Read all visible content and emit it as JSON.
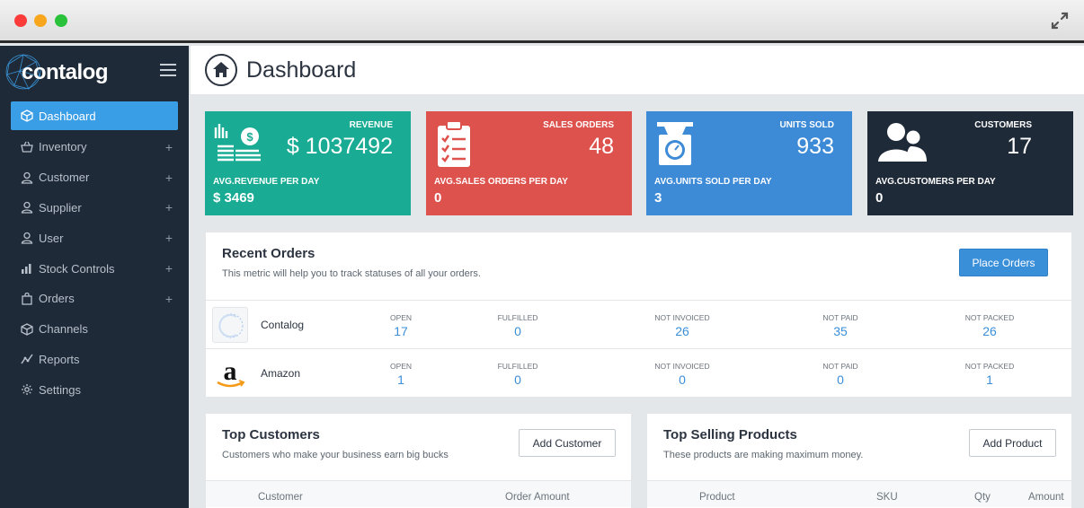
{
  "sidebar": {
    "logo": "contalog",
    "items": [
      {
        "label": "Dashboard",
        "icon": "cube-icon",
        "active": true,
        "expandable": false
      },
      {
        "label": "Inventory",
        "icon": "basket-icon",
        "active": false,
        "expandable": true
      },
      {
        "label": "Customer",
        "icon": "user-icon",
        "active": false,
        "expandable": true
      },
      {
        "label": "Supplier",
        "icon": "user-icon",
        "active": false,
        "expandable": true
      },
      {
        "label": "User",
        "icon": "user-icon",
        "active": false,
        "expandable": true
      },
      {
        "label": "Stock Controls",
        "icon": "bar-chart-icon",
        "active": false,
        "expandable": true
      },
      {
        "label": "Orders",
        "icon": "bag-icon",
        "active": false,
        "expandable": true
      },
      {
        "label": "Channels",
        "icon": "cube-icon",
        "active": false,
        "expandable": false
      },
      {
        "label": "Reports",
        "icon": "line-chart-icon",
        "active": false,
        "expandable": false
      },
      {
        "label": "Settings",
        "icon": "gear-icon",
        "active": false,
        "expandable": false
      }
    ],
    "plus": "+"
  },
  "header": {
    "title": "Dashboard"
  },
  "cards": [
    {
      "label": "REVENUE",
      "value": "$ 1037492",
      "sub_label": "AVG.REVENUE PER DAY",
      "sub_value": "$ 3469",
      "color": "#1aab94",
      "icon": "money-stack-icon"
    },
    {
      "label": "SALES ORDERS",
      "value": "48",
      "sub_label": "AVG.SALES ORDERS PER DAY",
      "sub_value": "0",
      "color": "#dd524d",
      "icon": "clipboard-icon"
    },
    {
      "label": "UNITS SOLD",
      "value": "933",
      "sub_label": "AVG.UNITS SOLD PER DAY",
      "sub_value": "3",
      "color": "#3d8ad6",
      "icon": "scale-icon"
    },
    {
      "label": "CUSTOMERS",
      "value": "17",
      "sub_label": "AVG.CUSTOMERS PER DAY",
      "sub_value": "0",
      "color": "#1f2a38",
      "icon": "users-icon"
    }
  ],
  "recent_orders": {
    "title": "Recent Orders",
    "subtitle": "This metric will help you to track statuses of all your orders.",
    "button": "Place Orders",
    "columns": [
      "OPEN",
      "FULFILLED",
      "NOT INVOICED",
      "NOT PAID",
      "NOT PACKED"
    ],
    "rows": [
      {
        "channel": "Contalog",
        "values": [
          "17",
          "0",
          "26",
          "35",
          "26"
        ]
      },
      {
        "channel": "Amazon",
        "values": [
          "1",
          "0",
          "0",
          "0",
          "1"
        ]
      }
    ]
  },
  "top_customers": {
    "title": "Top Customers",
    "subtitle": "Customers who make your business earn big bucks",
    "button": "Add Customer",
    "headers": [
      "Customer",
      "Order Amount"
    ]
  },
  "top_products": {
    "title": "Top Selling Products",
    "subtitle": "These products are making maximum money.",
    "button": "Add Product",
    "headers": [
      "Product",
      "SKU",
      "Qty",
      "Amount"
    ]
  }
}
